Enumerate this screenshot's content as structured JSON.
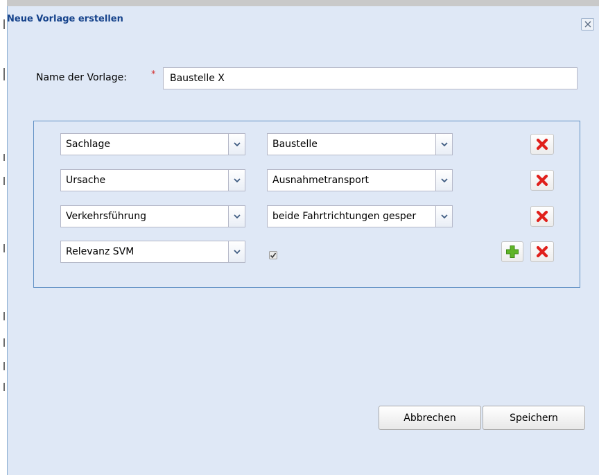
{
  "dialog": {
    "title": "Neue Vorlage erstellen",
    "close_symbol": "×"
  },
  "form": {
    "name_label": "Name der Vorlage:",
    "required_marker": "*",
    "name_value": "Baustelle X"
  },
  "rows": [
    {
      "field": "Sachlage",
      "value": "Baustelle"
    },
    {
      "field": "Ursache",
      "value": "Ausnahmetransport"
    },
    {
      "field": "Verkehrsführung",
      "value": "beide Fahrtrichtungen gesper"
    },
    {
      "field": "Relevanz SVM",
      "checked": true
    }
  ],
  "buttons": {
    "cancel": "Abbrechen",
    "save": "Speichern"
  },
  "icons": {
    "close": "close-icon",
    "dropdown": "chevron-down-icon",
    "delete": "red-x-icon",
    "add": "green-plus-icon",
    "check": "checkmark-icon"
  },
  "colors": {
    "dialog_bg": "#dfe8f6",
    "title": "#15428b",
    "panel_border": "#5f8fc4",
    "delete_red": "#e0201b",
    "add_green": "#5fb527"
  }
}
